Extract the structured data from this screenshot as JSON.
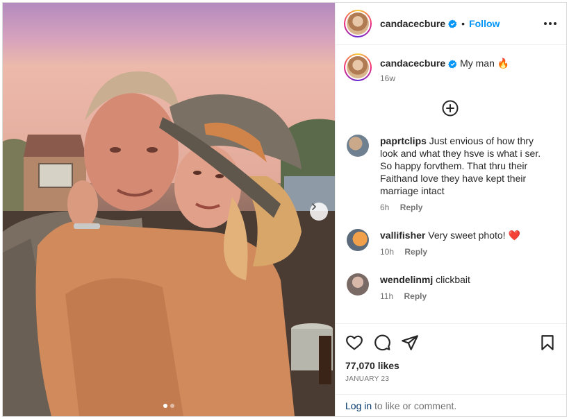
{
  "header": {
    "username": "candacecbure",
    "bullet": "•",
    "follow_label": "Follow",
    "verified_icon": "verified-badge-icon",
    "more_icon": "more-options-icon"
  },
  "caption": {
    "username": "candacecbure",
    "text": "My man 🔥",
    "time": "16w"
  },
  "add_icon": "plus-circle-icon",
  "comments": [
    {
      "username": "paprtclips",
      "text": "Just envious of how thry look and what they hsve is what i ser. So happy forvthem. That thru their Faithand love they have kept their marriage intact",
      "time": "6h",
      "reply_label": "Reply",
      "avatar_color": "#8a9aa6"
    },
    {
      "username": "vallifisher",
      "text": "Very sweet photo! ❤️",
      "time": "10h",
      "reply_label": "Reply",
      "avatar_color": "#e07a2c"
    },
    {
      "username": "wendelinmj",
      "text": "clickbait",
      "time": "11h",
      "reply_label": "Reply",
      "avatar_color": "#9c8c86"
    }
  ],
  "actions": {
    "like_icon": "heart-icon",
    "comment_icon": "comment-icon",
    "share_icon": "paper-plane-icon",
    "save_icon": "bookmark-icon"
  },
  "likes": "77,070 likes",
  "date": "JANUARY 23",
  "login": {
    "link_label": "Log in",
    "suffix": " to like or comment."
  },
  "carousel": {
    "next_icon": "chevron-right-icon",
    "total": 2,
    "current": 1
  }
}
